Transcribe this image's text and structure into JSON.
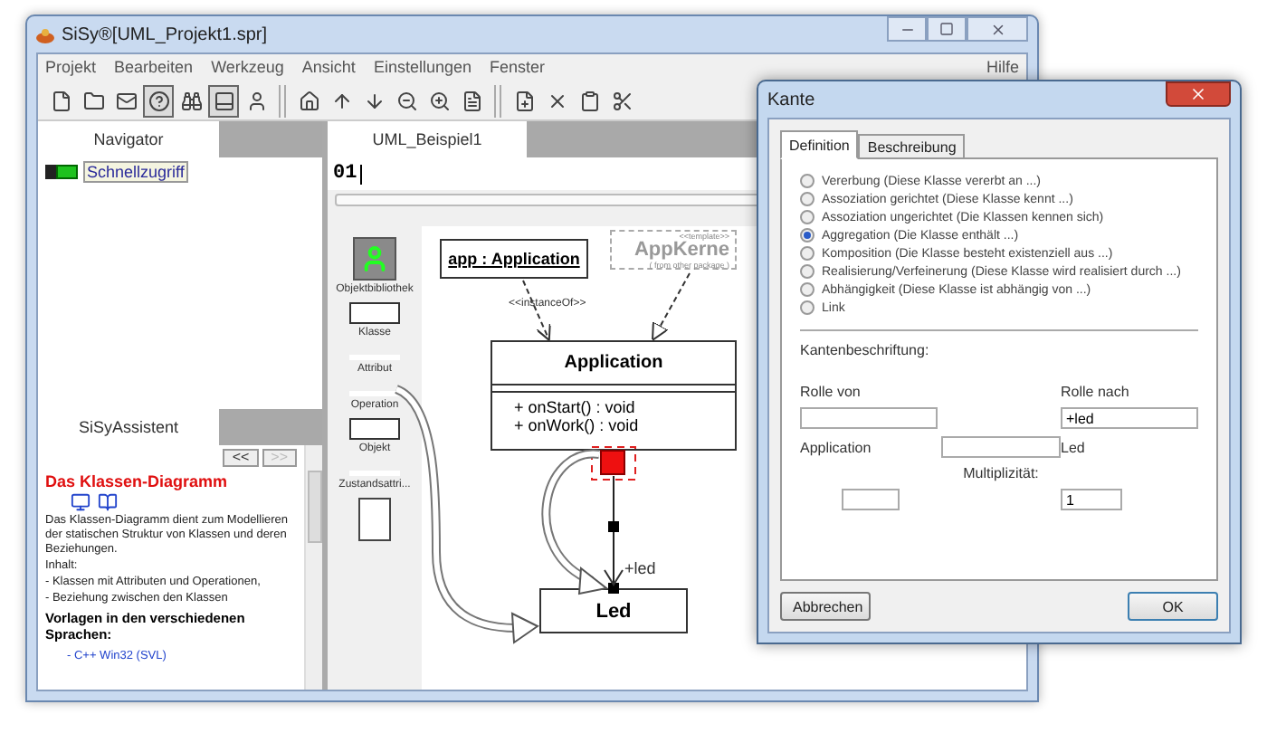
{
  "window": {
    "title": "SiSy®[UML_Projekt1.spr]"
  },
  "menu": [
    "Projekt",
    "Bearbeiten",
    "Werkzeug",
    "Ansicht",
    "Einstellungen",
    "Fenster",
    "Hilfe"
  ],
  "toolbar": [
    {
      "pressed": false
    },
    {
      "pressed": false
    },
    {
      "pressed": false
    },
    {
      "pressed": true
    },
    {
      "pressed": false
    },
    {
      "pressed": true
    },
    {
      "pressed": false
    },
    {
      "pressed": false
    },
    {
      "pressed": false
    },
    {
      "pressed": false
    },
    {
      "pressed": false
    },
    {
      "pressed": false
    },
    {
      "pressed": false
    },
    {
      "pressed": false
    },
    {
      "pressed": false
    },
    {
      "pressed": false
    },
    {
      "pressed": false
    }
  ],
  "navigator": {
    "title": "Navigator",
    "items": [
      {
        "label": "Schnellzugriff",
        "selected": true
      }
    ]
  },
  "assistant": {
    "title": "SiSyAssistent",
    "nav_buttons": [
      {
        "label": "<<",
        "disabled": false
      },
      {
        "label": ">>",
        "disabled": true
      }
    ],
    "heading": "Das Klassen-Diagramm",
    "text": "Das Klassen-Diagramm dient zum Modellieren der statischen Struktur von Klassen und deren Beziehungen.",
    "contents_label": "Inhalt:",
    "bullets": [
      "- Klassen mit Attributen und Operationen,",
      "- Beziehung zwischen den Klassen"
    ],
    "templates_heading": "Vorlagen in den verschiedenen Sprachen:",
    "links": [
      "- C++ Win32 (SVL)"
    ]
  },
  "editor": {
    "tab": "UML_Beispiel1",
    "line": "01"
  },
  "toolbox": [
    {
      "label": "Objektbibliothek",
      "kind": "runner"
    },
    {
      "label": "Klasse",
      "kind": "class"
    },
    {
      "label": "Attribut",
      "kind": "bar"
    },
    {
      "label": "Operation",
      "kind": "bar"
    },
    {
      "label": "Objekt",
      "kind": "class"
    },
    {
      "label": "Zustandsattri...",
      "kind": "bar"
    },
    {
      "kind": "document"
    }
  ],
  "diagram": {
    "object": "app : Application",
    "template": {
      "stereotype": "<<template>>",
      "name": "AppKerne",
      "note": "( from other package )"
    },
    "instance_label": "<<instanceOf>>",
    "class": {
      "name": "Application",
      "operations": [
        "+ onStart() : void",
        "+ onWork() : void"
      ]
    },
    "role": "+led",
    "target": "Led"
  },
  "dialog": {
    "title": "Kante",
    "tabs": [
      {
        "label": "Definition",
        "selected": true
      },
      {
        "label": "Beschreibung",
        "selected": false
      }
    ],
    "options": [
      {
        "label": "Vererbung  (Diese Klasse vererbt an ...)",
        "selected": false
      },
      {
        "label": "Assoziation gerichtet  (Diese Klasse kennt ...)",
        "selected": false
      },
      {
        "label": "Assoziation ungerichtet  (Die Klassen kennen sich)",
        "selected": false
      },
      {
        "label": "Aggregation  (Die Klasse enthält ...)",
        "selected": true
      },
      {
        "label": "Komposition  (Die Klasse besteht existenziell aus ...)",
        "selected": false
      },
      {
        "label": "Realisierung/Verfeinerung  (Diese Klasse wird realisiert durch ...)",
        "selected": false
      },
      {
        "label": "Abhängigkeit  (Diese Klasse ist abhängig von ...)",
        "selected": false
      },
      {
        "label": "Link",
        "selected": false
      }
    ],
    "section": "Kantenbeschriftung:",
    "role_from_label": "Rolle von",
    "role_to_label": "Rolle nach",
    "role_to": "+led",
    "from_class": "Application",
    "to_class": "Led",
    "multiplicity_label": "Multiplizität:",
    "multiplicity_to": "1",
    "cancel": "Abbrechen",
    "ok": "OK"
  }
}
